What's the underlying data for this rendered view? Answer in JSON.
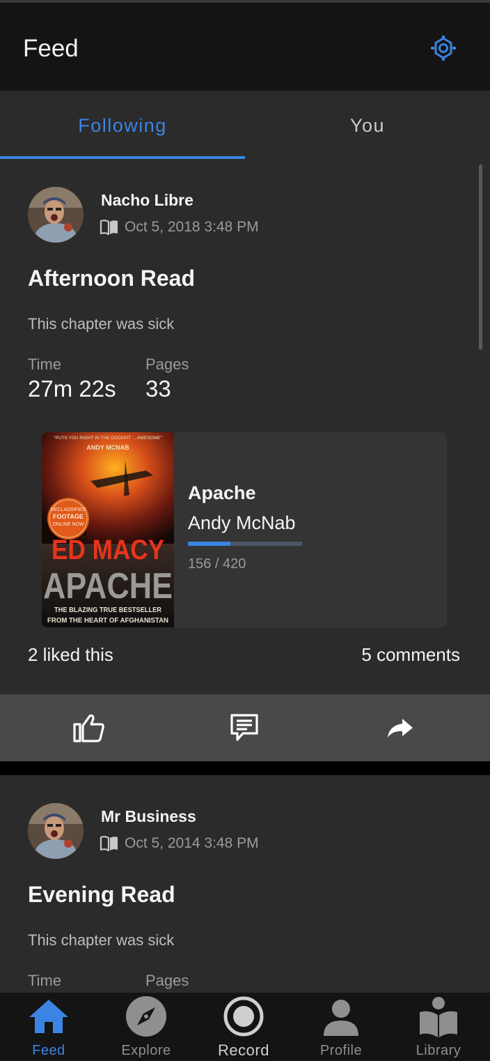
{
  "header": {
    "title": "Feed",
    "settings_icon": "settings-gear-icon"
  },
  "tabs": [
    {
      "label": "Following",
      "active": true
    },
    {
      "label": "You",
      "active": false
    }
  ],
  "accent_color": "#3b84e4",
  "posts": [
    {
      "user": "Nacho Libre",
      "date": "Oct 5, 2018 3:48 PM",
      "title": "Afternoon Read",
      "description": "This chapter was sick",
      "stats": [
        {
          "label": "Time",
          "value": "27m 22s"
        },
        {
          "label": "Pages",
          "value": "33"
        }
      ],
      "book": {
        "title": "Apache",
        "author": "Andy McNab",
        "progress_text": "156 / 420",
        "pages_read": 156,
        "pages_total": 420,
        "cover": {
          "quote": "\"PUTS YOU RIGHT IN THE COCKPIT ... AWESOME\"",
          "quote_author": "ANDY MCNAB",
          "badge_line1": "DECLASSIFIED",
          "badge_line2": "FOOTAGE",
          "badge_line3": "ONLINE NOW",
          "author": "ED MACY",
          "title": "APACHE",
          "tagline1": "THE BLAZING TRUE BESTSELLER",
          "tagline2": "FROM THE HEART OF AFGHANISTAN"
        }
      },
      "likes": "2 liked this",
      "comments": "5 comments"
    },
    {
      "user": "Mr Business",
      "date": "Oct 5, 2014 3:48 PM",
      "title": "Evening Read",
      "description": "This chapter was sick",
      "stats": [
        {
          "label": "Time"
        },
        {
          "label": "Pages"
        }
      ]
    }
  ],
  "actions": [
    "thumbs-up-icon",
    "comment-icon",
    "share-icon"
  ],
  "bottom_nav": [
    {
      "label": "Feed",
      "icon": "home-icon",
      "active": true
    },
    {
      "label": "Explore",
      "icon": "compass-icon",
      "active": false
    },
    {
      "label": "Record",
      "icon": "record-icon",
      "active": false
    },
    {
      "label": "Profile",
      "icon": "person-icon",
      "active": false
    },
    {
      "label": "Library",
      "icon": "library-icon",
      "active": false
    }
  ]
}
